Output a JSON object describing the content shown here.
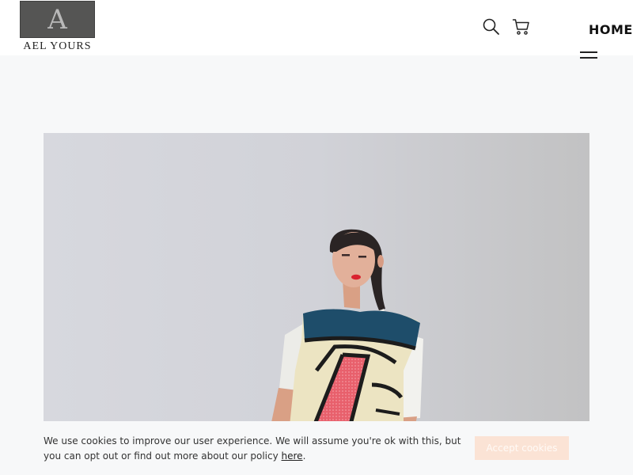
{
  "brand": {
    "logo_letter": "A",
    "name": "AEL YOURS"
  },
  "header": {
    "nav_home": "HOME",
    "icons": [
      "search-icon",
      "cart-icon",
      "menu-icon"
    ]
  },
  "cookie": {
    "text_before": "We use cookies to improve our user experience. We will assume you're ok with this, but you can opt out or find out more about our policy ",
    "link": "here",
    "text_after": ".",
    "accept_label": "Accept cookies"
  },
  "colors": {
    "accent_button": "#fbe3d5",
    "logo_box": "#555554",
    "top_colorblock": "#1e4d6a",
    "red_panel": "#e95f6b"
  }
}
